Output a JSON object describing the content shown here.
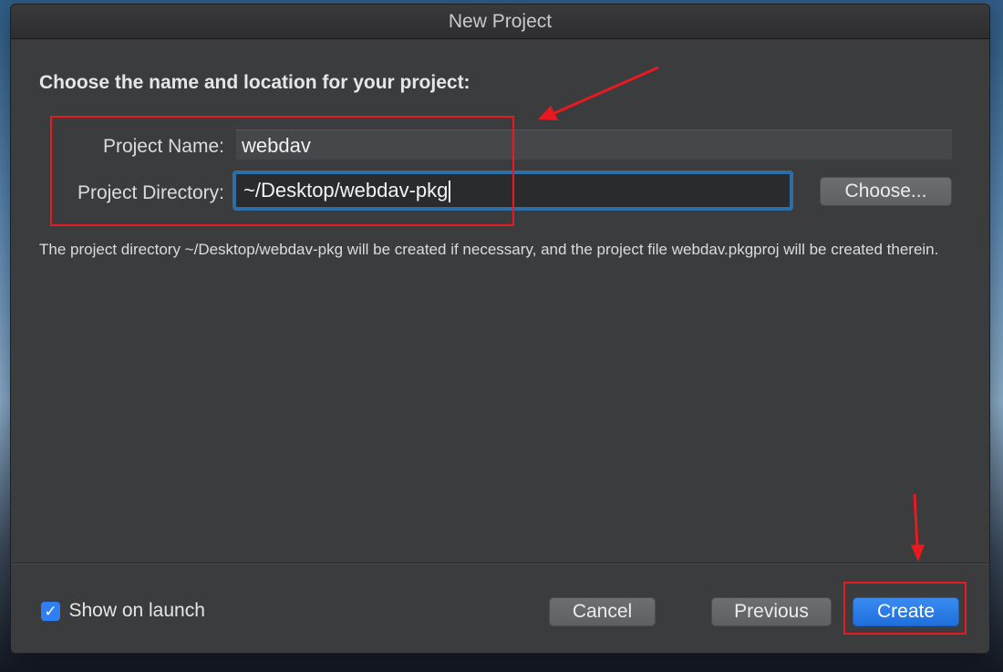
{
  "window": {
    "title": "New Project"
  },
  "form": {
    "heading": "Choose the name and location for your project:",
    "project_name_label": "Project Name:",
    "project_name_value": "webdav",
    "project_directory_label": "Project Directory:",
    "project_directory_value": "~/Desktop/webdav-pkg",
    "choose_button": "Choose...",
    "description": "The project directory ~/Desktop/webdav-pkg will be created if necessary, and the project file webdav.pkgproj will be created therein."
  },
  "footer": {
    "show_on_launch_label": "Show on launch",
    "show_on_launch_checked": true,
    "cancel_button": "Cancel",
    "previous_button": "Previous",
    "create_button": "Create"
  },
  "colors": {
    "window_bg": "#3b3c3e",
    "accent_blue": "#1f6fdc",
    "focus_ring": "#2e6ea6",
    "annotation_red": "#e8191f"
  },
  "icons": {
    "checkbox": "checkmark-icon",
    "annotations": [
      "arrow-annotation-icon"
    ]
  }
}
